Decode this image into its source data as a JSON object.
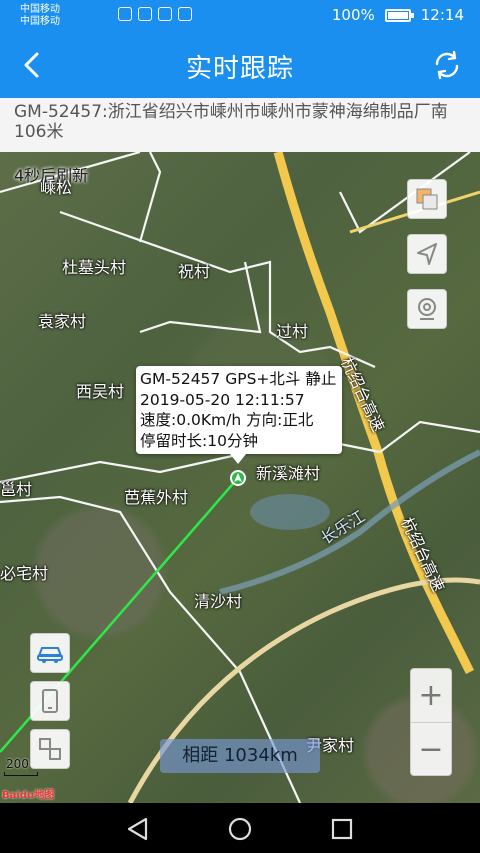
{
  "status_bar": {
    "carrier1": "中国移动",
    "carrier2": "中国移动",
    "battery": "100%",
    "time": "12:14"
  },
  "app_bar": {
    "title": "实时跟踪"
  },
  "address": {
    "text": "GM-52457:浙江省绍兴市嵊州市嵊州市蒙神海绵制品厂南106米"
  },
  "map": {
    "refresh_hint": "4秒后刷新",
    "places": [
      "嵊松",
      "杜墓头村",
      "祝村",
      "袁家村",
      "过村",
      "西吴村",
      "新溪滩村",
      "邕村",
      "芭蕉外村",
      "长乐江",
      "杭绍台高速",
      "杭绍台高速",
      "必宅村",
      "清沙村",
      "尹家村"
    ],
    "info": {
      "line1": "GM-52457 GPS+北斗 静止",
      "line2": "2019-05-20 12:11:57",
      "line3": "速度:0.0Km/h  方向:正北",
      "line4": "停留时长:10分钟"
    },
    "distance": "相距 1034km",
    "scale": "200",
    "logo": "Baidu地图",
    "zoom_in": "+",
    "zoom_out": "−"
  },
  "icons": [
    "back-icon",
    "refresh-icon",
    "layers-icon",
    "locate-icon",
    "street-view-icon",
    "car-icon",
    "phone-icon",
    "switch-icon"
  ]
}
